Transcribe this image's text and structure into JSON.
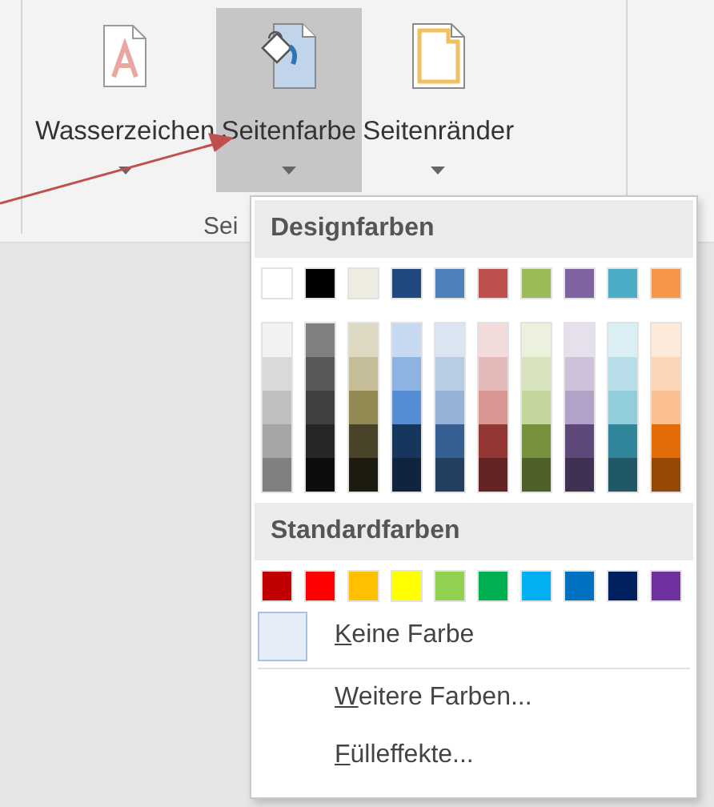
{
  "ribbon": {
    "buttons": [
      {
        "label": "Wasserzeichen",
        "kind": "watermark",
        "selected": false
      },
      {
        "label": "Seitenfarbe",
        "kind": "page-color",
        "selected": true
      },
      {
        "label": "Seitenränder",
        "kind": "page-borders",
        "selected": false
      }
    ],
    "group_label": "Sei"
  },
  "color_menu": {
    "design_title": "Designfarben",
    "design_colors": [
      {
        "color": "#ffffff",
        "shades": [
          {
            "color": "#f2f2f2"
          },
          {
            "color": "#d9d9d9"
          },
          {
            "color": "#bfbfbf"
          },
          {
            "color": "#a6a6a6"
          },
          {
            "color": "#808080"
          }
        ]
      },
      {
        "color": "#000000",
        "shades": [
          {
            "color": "#808080"
          },
          {
            "color": "#595959"
          },
          {
            "color": "#404040"
          },
          {
            "color": "#262626"
          },
          {
            "color": "#0d0d0d"
          }
        ]
      },
      {
        "color": "#eeece1",
        "shades": [
          {
            "color": "#ddd9c3"
          },
          {
            "color": "#c4bd97"
          },
          {
            "color": "#938953"
          },
          {
            "color": "#494429"
          },
          {
            "color": "#1d1b10"
          }
        ]
      },
      {
        "color": "#1f497d",
        "shades": [
          {
            "color": "#c6d9f0"
          },
          {
            "color": "#8db3e2"
          },
          {
            "color": "#548dd4"
          },
          {
            "color": "#17365d"
          },
          {
            "color": "#0f243e"
          }
        ]
      },
      {
        "color": "#4f81bd",
        "shades": [
          {
            "color": "#dbe5f1"
          },
          {
            "color": "#b8cce4"
          },
          {
            "color": "#95b3d7"
          },
          {
            "color": "#366092"
          },
          {
            "color": "#244061"
          }
        ]
      },
      {
        "color": "#c0504d",
        "shades": [
          {
            "color": "#f2dcdb"
          },
          {
            "color": "#e5b9b7"
          },
          {
            "color": "#d99694"
          },
          {
            "color": "#953734"
          },
          {
            "color": "#632423"
          }
        ]
      },
      {
        "color": "#9bbb59",
        "shades": [
          {
            "color": "#ebf1dd"
          },
          {
            "color": "#d7e3bc"
          },
          {
            "color": "#c3d69b"
          },
          {
            "color": "#76923c"
          },
          {
            "color": "#4f6128"
          }
        ]
      },
      {
        "color": "#8064a2",
        "shades": [
          {
            "color": "#e5e0ec"
          },
          {
            "color": "#ccc1d9"
          },
          {
            "color": "#b2a2c7"
          },
          {
            "color": "#5f497a"
          },
          {
            "color": "#3f3151"
          }
        ]
      },
      {
        "color": "#4bacc6",
        "shades": [
          {
            "color": "#dbeef3"
          },
          {
            "color": "#b7dde8"
          },
          {
            "color": "#92cddc"
          },
          {
            "color": "#31859b"
          },
          {
            "color": "#205867"
          }
        ]
      },
      {
        "color": "#f79646",
        "shades": [
          {
            "color": "#fdeada"
          },
          {
            "color": "#fbd5b5"
          },
          {
            "color": "#fac08f"
          },
          {
            "color": "#e36c09"
          },
          {
            "color": "#974806"
          }
        ]
      }
    ],
    "standard_title": "Standardfarben",
    "standard_colors": [
      {
        "color": "#c00000"
      },
      {
        "color": "#ff0000"
      },
      {
        "color": "#ffc000"
      },
      {
        "color": "#ffff00"
      },
      {
        "color": "#92d050"
      },
      {
        "color": "#00b050"
      },
      {
        "color": "#00b0f0"
      },
      {
        "color": "#0070c0"
      },
      {
        "color": "#002060"
      },
      {
        "color": "#7030a0"
      }
    ],
    "items": [
      {
        "label": "Keine Farbe",
        "kind": "no-color"
      },
      {
        "label": "Weitere Farben...",
        "kind": "plain"
      },
      {
        "label": "Fülleffekte...",
        "kind": "plain"
      }
    ]
  }
}
